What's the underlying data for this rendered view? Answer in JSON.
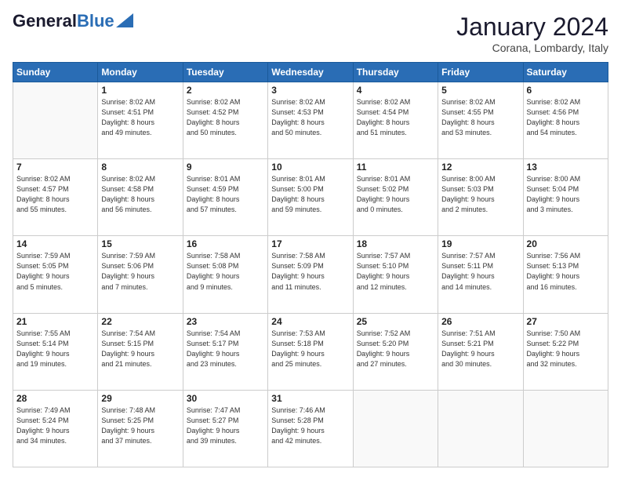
{
  "header": {
    "logo_general": "General",
    "logo_blue": "Blue",
    "month_title": "January 2024",
    "location": "Corana, Lombardy, Italy"
  },
  "days_of_week": [
    "Sunday",
    "Monday",
    "Tuesday",
    "Wednesday",
    "Thursday",
    "Friday",
    "Saturday"
  ],
  "weeks": [
    [
      {
        "num": "",
        "info": ""
      },
      {
        "num": "1",
        "info": "Sunrise: 8:02 AM\nSunset: 4:51 PM\nDaylight: 8 hours\nand 49 minutes."
      },
      {
        "num": "2",
        "info": "Sunrise: 8:02 AM\nSunset: 4:52 PM\nDaylight: 8 hours\nand 50 minutes."
      },
      {
        "num": "3",
        "info": "Sunrise: 8:02 AM\nSunset: 4:53 PM\nDaylight: 8 hours\nand 50 minutes."
      },
      {
        "num": "4",
        "info": "Sunrise: 8:02 AM\nSunset: 4:54 PM\nDaylight: 8 hours\nand 51 minutes."
      },
      {
        "num": "5",
        "info": "Sunrise: 8:02 AM\nSunset: 4:55 PM\nDaylight: 8 hours\nand 53 minutes."
      },
      {
        "num": "6",
        "info": "Sunrise: 8:02 AM\nSunset: 4:56 PM\nDaylight: 8 hours\nand 54 minutes."
      }
    ],
    [
      {
        "num": "7",
        "info": "Sunrise: 8:02 AM\nSunset: 4:57 PM\nDaylight: 8 hours\nand 55 minutes."
      },
      {
        "num": "8",
        "info": "Sunrise: 8:02 AM\nSunset: 4:58 PM\nDaylight: 8 hours\nand 56 minutes."
      },
      {
        "num": "9",
        "info": "Sunrise: 8:01 AM\nSunset: 4:59 PM\nDaylight: 8 hours\nand 57 minutes."
      },
      {
        "num": "10",
        "info": "Sunrise: 8:01 AM\nSunset: 5:00 PM\nDaylight: 8 hours\nand 59 minutes."
      },
      {
        "num": "11",
        "info": "Sunrise: 8:01 AM\nSunset: 5:02 PM\nDaylight: 9 hours\nand 0 minutes."
      },
      {
        "num": "12",
        "info": "Sunrise: 8:00 AM\nSunset: 5:03 PM\nDaylight: 9 hours\nand 2 minutes."
      },
      {
        "num": "13",
        "info": "Sunrise: 8:00 AM\nSunset: 5:04 PM\nDaylight: 9 hours\nand 3 minutes."
      }
    ],
    [
      {
        "num": "14",
        "info": "Sunrise: 7:59 AM\nSunset: 5:05 PM\nDaylight: 9 hours\nand 5 minutes."
      },
      {
        "num": "15",
        "info": "Sunrise: 7:59 AM\nSunset: 5:06 PM\nDaylight: 9 hours\nand 7 minutes."
      },
      {
        "num": "16",
        "info": "Sunrise: 7:58 AM\nSunset: 5:08 PM\nDaylight: 9 hours\nand 9 minutes."
      },
      {
        "num": "17",
        "info": "Sunrise: 7:58 AM\nSunset: 5:09 PM\nDaylight: 9 hours\nand 11 minutes."
      },
      {
        "num": "18",
        "info": "Sunrise: 7:57 AM\nSunset: 5:10 PM\nDaylight: 9 hours\nand 12 minutes."
      },
      {
        "num": "19",
        "info": "Sunrise: 7:57 AM\nSunset: 5:11 PM\nDaylight: 9 hours\nand 14 minutes."
      },
      {
        "num": "20",
        "info": "Sunrise: 7:56 AM\nSunset: 5:13 PM\nDaylight: 9 hours\nand 16 minutes."
      }
    ],
    [
      {
        "num": "21",
        "info": "Sunrise: 7:55 AM\nSunset: 5:14 PM\nDaylight: 9 hours\nand 19 minutes."
      },
      {
        "num": "22",
        "info": "Sunrise: 7:54 AM\nSunset: 5:15 PM\nDaylight: 9 hours\nand 21 minutes."
      },
      {
        "num": "23",
        "info": "Sunrise: 7:54 AM\nSunset: 5:17 PM\nDaylight: 9 hours\nand 23 minutes."
      },
      {
        "num": "24",
        "info": "Sunrise: 7:53 AM\nSunset: 5:18 PM\nDaylight: 9 hours\nand 25 minutes."
      },
      {
        "num": "25",
        "info": "Sunrise: 7:52 AM\nSunset: 5:20 PM\nDaylight: 9 hours\nand 27 minutes."
      },
      {
        "num": "26",
        "info": "Sunrise: 7:51 AM\nSunset: 5:21 PM\nDaylight: 9 hours\nand 30 minutes."
      },
      {
        "num": "27",
        "info": "Sunrise: 7:50 AM\nSunset: 5:22 PM\nDaylight: 9 hours\nand 32 minutes."
      }
    ],
    [
      {
        "num": "28",
        "info": "Sunrise: 7:49 AM\nSunset: 5:24 PM\nDaylight: 9 hours\nand 34 minutes."
      },
      {
        "num": "29",
        "info": "Sunrise: 7:48 AM\nSunset: 5:25 PM\nDaylight: 9 hours\nand 37 minutes."
      },
      {
        "num": "30",
        "info": "Sunrise: 7:47 AM\nSunset: 5:27 PM\nDaylight: 9 hours\nand 39 minutes."
      },
      {
        "num": "31",
        "info": "Sunrise: 7:46 AM\nSunset: 5:28 PM\nDaylight: 9 hours\nand 42 minutes."
      },
      {
        "num": "",
        "info": ""
      },
      {
        "num": "",
        "info": ""
      },
      {
        "num": "",
        "info": ""
      }
    ]
  ]
}
